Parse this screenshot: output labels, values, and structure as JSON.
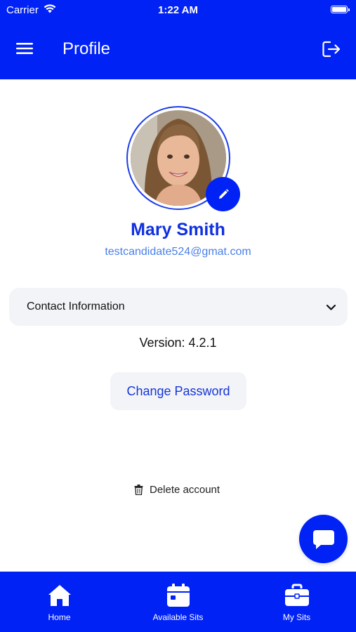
{
  "status_bar": {
    "carrier": "Carrier",
    "time": "1:22 AM"
  },
  "header": {
    "title": "Profile"
  },
  "profile": {
    "name": "Mary Smith",
    "email": "testcandidate524@gmat.com"
  },
  "contact": {
    "label": "Contact Information"
  },
  "version": "Version: 4.2.1",
  "change_password": "Change Password",
  "delete_account": "Delete account",
  "tabs": [
    {
      "label": "Home",
      "icon": "home-icon"
    },
    {
      "label": "Available Sits",
      "icon": "calendar-icon"
    },
    {
      "label": "My Sits",
      "icon": "briefcase-icon"
    }
  ],
  "colors": {
    "primary": "#0022f5",
    "name_text": "#0f30e0",
    "email_text": "#4a7fe8",
    "surface": "#f3f4f8"
  }
}
